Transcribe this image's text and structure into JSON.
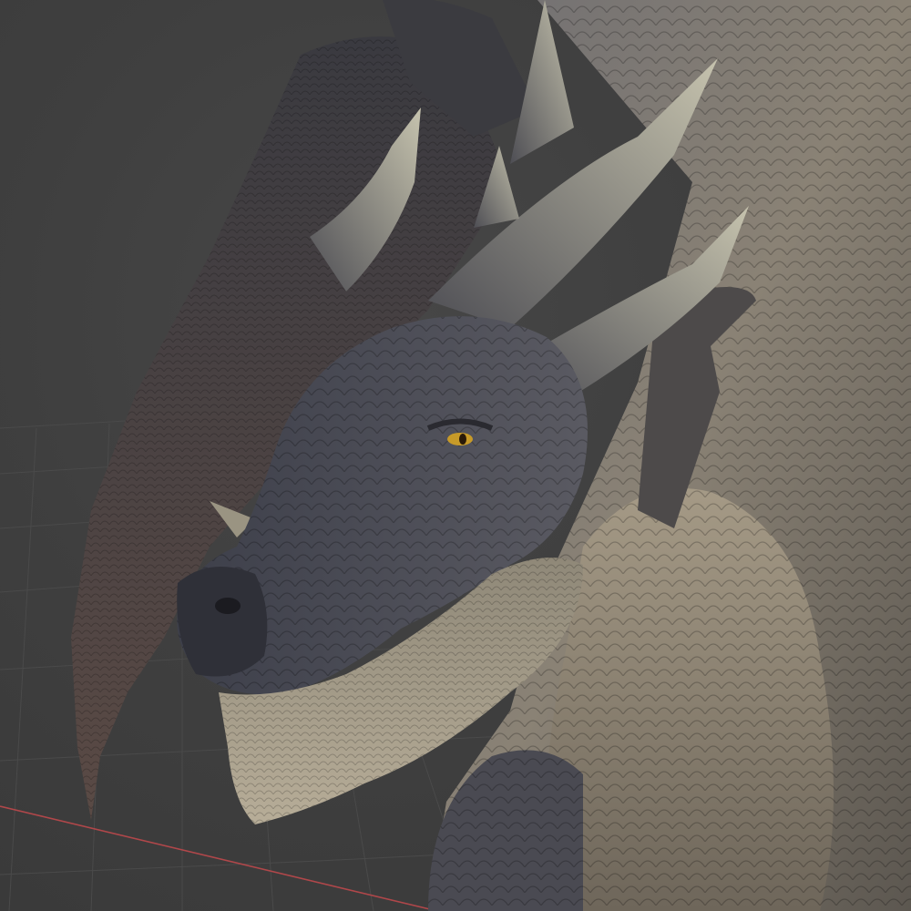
{
  "viewport": {
    "background_color": "#3d3d3d",
    "grid_color": "#4a4a4a",
    "x_axis_color": "#b0474a",
    "subject": "dragon-model"
  }
}
